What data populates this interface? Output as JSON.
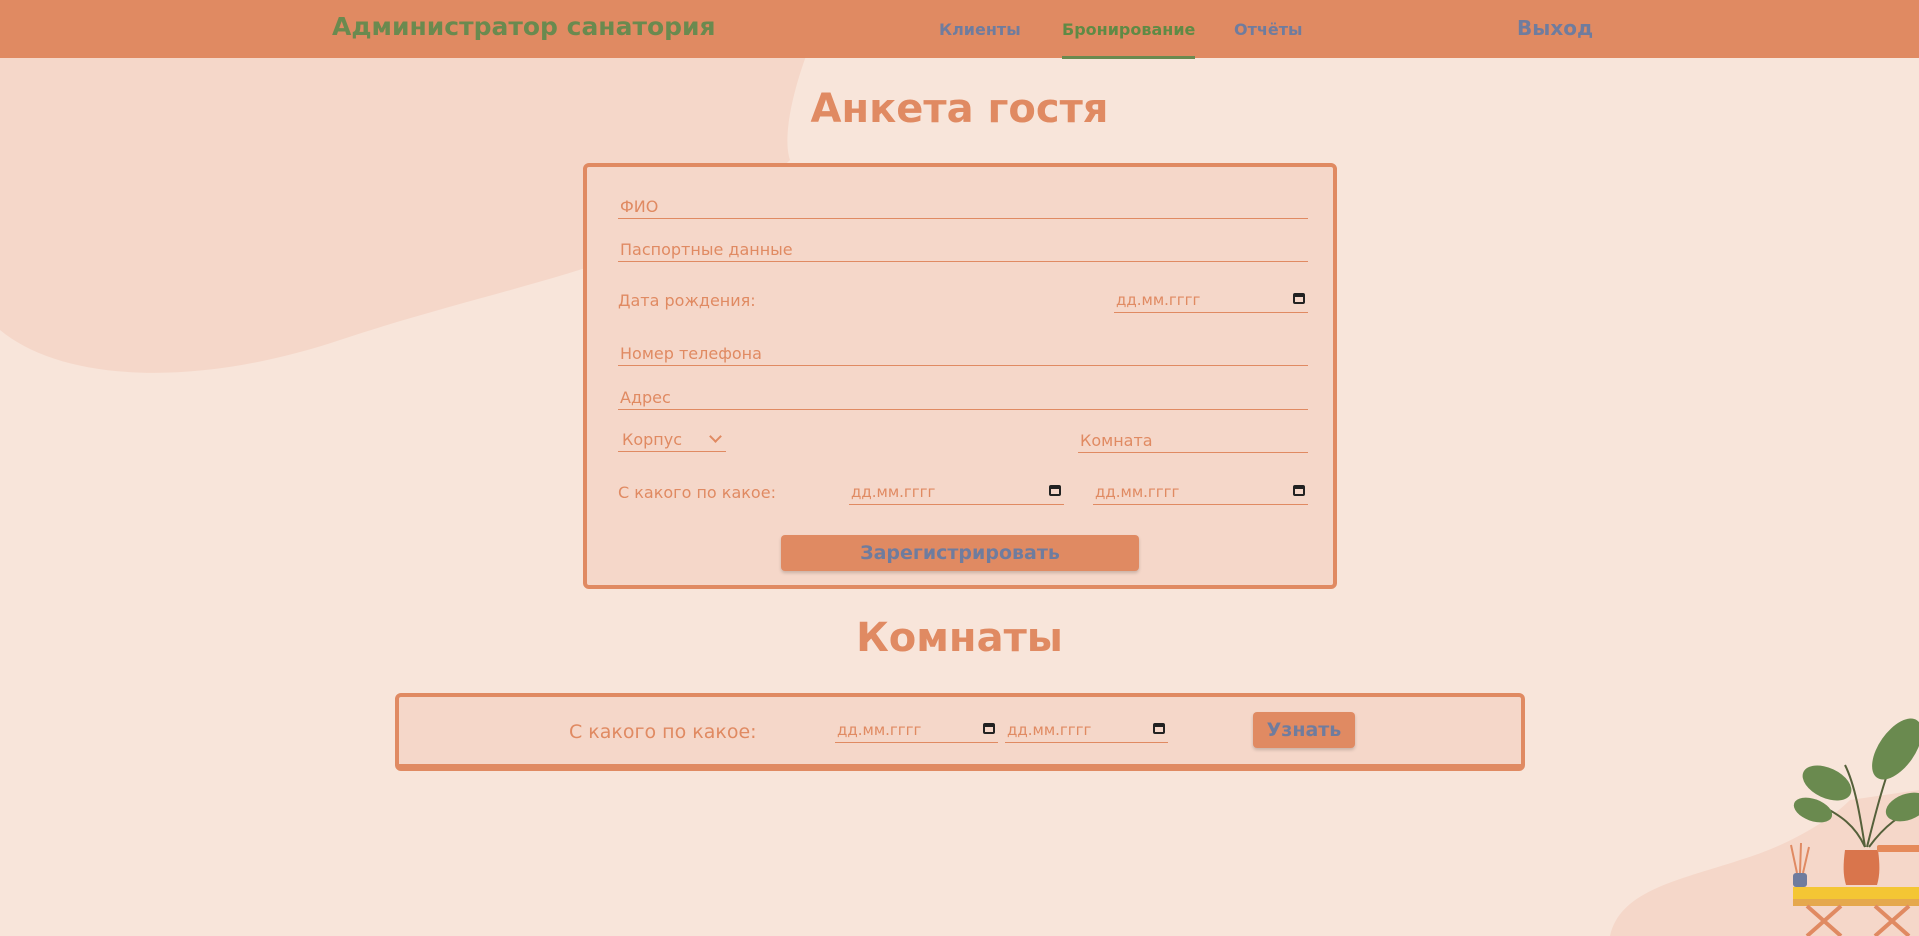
{
  "header": {
    "brand": "Администратор санатория",
    "nav": [
      {
        "label": "Клиенты"
      },
      {
        "label": "Бронирование"
      },
      {
        "label": "Отчёты"
      }
    ],
    "logout_label": "Выход"
  },
  "guest_form": {
    "title": "Анкета гостя",
    "full_name_placeholder": "ФИО",
    "passport_placeholder": "Паспортные данные",
    "birth_date_label": "Дата рождения:",
    "birth_date_value": "дд.мм.гггг",
    "phone_placeholder": "Номер телефона",
    "address_placeholder": "Адрес",
    "building_select_value": "Корпус",
    "room_placeholder": "Комната",
    "period_label": "С какого по какое:",
    "date_from_value": "дд.мм.гггг",
    "date_to_value": "дд.мм.гггг",
    "submit_label": "Зарегистрировать"
  },
  "rooms": {
    "title": "Комнаты",
    "period_label": "С какого по какое:",
    "date_from_value": "дд.мм.гггг",
    "date_to_value": "дд.мм.гггг",
    "check_label": "Узнать"
  },
  "colors": {
    "accent": "#e08a62",
    "background": "#f8e5da",
    "card": "#f5d7c9",
    "brand_green": "#6a8a4f",
    "link_blue": "#6f7c9e"
  }
}
